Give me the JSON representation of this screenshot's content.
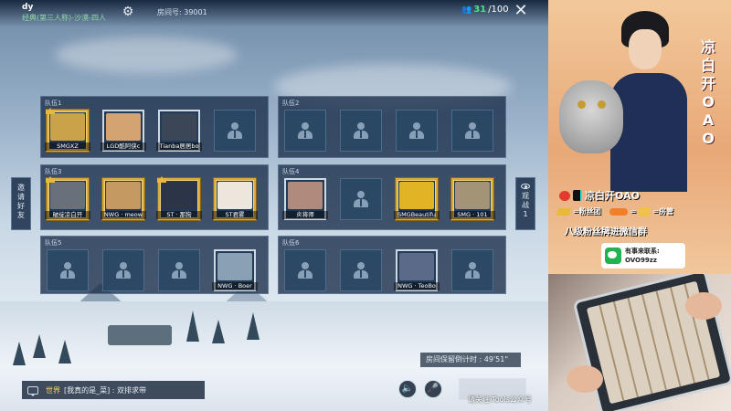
{
  "header": {
    "username": "dy",
    "mode": "经典(第三人称)-沙漠-四人",
    "room_id": "房间号: 39001",
    "players_current": "31",
    "players_total": "/100"
  },
  "teams": [
    {
      "label": "队伍1",
      "slots": [
        {
          "name": "SMGXZ",
          "filled": true,
          "gold": true,
          "leader": true,
          "color": "#c9a24a"
        },
        {
          "name": "LGD酷阿侠c",
          "filled": true,
          "gold": false,
          "leader": false,
          "color": "#d3a472"
        },
        {
          "name": "Tianba居居bo",
          "filled": true,
          "gold": false,
          "leader": false,
          "color": "#3b4757"
        },
        {
          "name": "",
          "filled": false
        }
      ]
    },
    {
      "label": "队伍2",
      "slots": [
        {
          "name": "",
          "filled": false
        },
        {
          "name": "",
          "filled": false
        },
        {
          "name": "",
          "filled": false
        },
        {
          "name": "",
          "filled": false
        }
      ]
    },
    {
      "label": "队伍3",
      "slots": [
        {
          "name": "破绽凉白开",
          "filled": true,
          "gold": true,
          "leader": true,
          "color": "#6a6f7c"
        },
        {
          "name": "NWG · meow",
          "filled": true,
          "gold": true,
          "leader": false,
          "color": "#c49a62"
        },
        {
          "name": "ST · 那狗",
          "filled": true,
          "gold": true,
          "leader": true,
          "color": "#2b3547"
        },
        {
          "name": "ST君雾",
          "filled": true,
          "gold": true,
          "leader": false,
          "color": "#ece6dc"
        }
      ]
    },
    {
      "label": "队伍4",
      "slots": [
        {
          "name": "炎将师",
          "filled": true,
          "gold": false,
          "leader": false,
          "color": "#b08a7a"
        },
        {
          "name": "",
          "filled": false
        },
        {
          "name": "SMGBeautifu",
          "filled": true,
          "gold": true,
          "leader": false,
          "color": "#e0b424"
        },
        {
          "name": "SMG · 101",
          "filled": true,
          "gold": true,
          "leader": false,
          "color": "#a39477"
        }
      ]
    },
    {
      "label": "队伍5",
      "slots": [
        {
          "name": "",
          "filled": false
        },
        {
          "name": "",
          "filled": false
        },
        {
          "name": "",
          "filled": false
        },
        {
          "name": "NWG · Boer",
          "filled": true,
          "gold": false,
          "leader": false,
          "color": "#8aa0b3"
        }
      ]
    },
    {
      "label": "队伍6",
      "slots": [
        {
          "name": "",
          "filled": false
        },
        {
          "name": "",
          "filled": false
        },
        {
          "name": "NWG · TeoBo",
          "filled": true,
          "gold": false,
          "leader": false,
          "color": "#5a6a88"
        },
        {
          "name": "",
          "filled": false
        }
      ]
    }
  ],
  "side": {
    "invite_label": "邀请好友",
    "spectate_label": "观战",
    "spectate_count": "1"
  },
  "bottom": {
    "countdown": "房间保留倒计时 : 49'51\"",
    "chat_channel": "世界",
    "chat_message": "[我真的是_菜] : 双排求带",
    "watermark": "请关注iTools公众号"
  },
  "overlay": {
    "vertical_title": [
      "凉",
      "白",
      "开",
      "O",
      "A",
      "O"
    ],
    "social_handle": "凉白开OAO",
    "legend_fan_group": "=粉丝团",
    "legend_room_admin": "=房管",
    "group_text": "八级粉丝牌进微信群",
    "wechat_title": "有事来联系:",
    "wechat_id": "OVO99zz"
  },
  "colors": {
    "accent_green": "#4fe08a",
    "gold_frame": "#d9ab3c",
    "panel": "#182c48"
  }
}
